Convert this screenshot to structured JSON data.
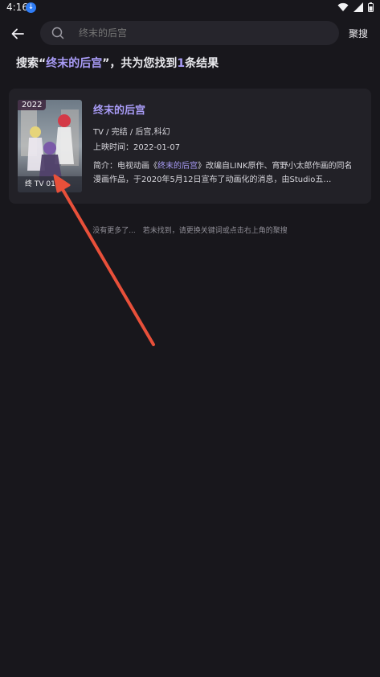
{
  "status_bar": {
    "time": "4:16"
  },
  "header": {
    "search": {
      "placeholder": "终末的后宫"
    },
    "action_label": "聚搜"
  },
  "results_heading": {
    "prefix": "搜索",
    "quote_open": "“",
    "keyword": "终末的后宫",
    "quote_close": "”",
    "middle": "，共为您找到",
    "count": "1",
    "suffix": "条结果"
  },
  "result": {
    "year": "2022",
    "title": "终末的后宫",
    "meta": "TV / 完结 / 后宫,科幻",
    "release_date": "上映时间：2022-01-07",
    "summary_prefix": "简介：电视动画《",
    "summary_title": "终末的后宫",
    "summary_suffix": "》改编自LINK原作、宵野小太郎作画的同名漫画作品，于2020年5月12日宣布了动画化的消息，由Studio五…",
    "poster_caption": "终 TV 01月"
  },
  "footer_note": "没有更多了...　若未找到，请更换关键词或点击右上角的聚搜",
  "colors": {
    "background": "#18171c",
    "card": "#222127",
    "accent": "#a99cf7",
    "arrow": "#e8503a"
  }
}
